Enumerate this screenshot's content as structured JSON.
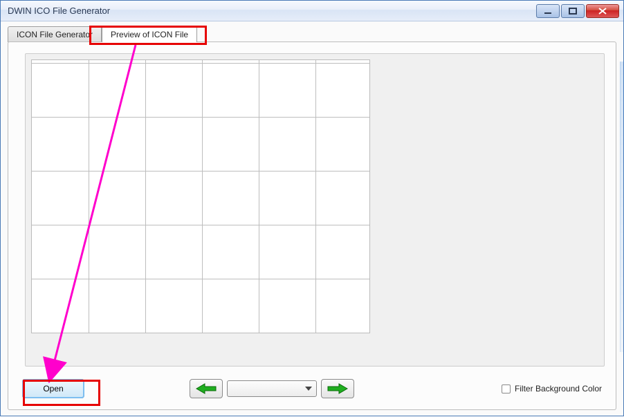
{
  "window": {
    "title": "DWIN ICO File Generator"
  },
  "tabs": {
    "generator": {
      "label": "ICON File Generator"
    },
    "preview": {
      "label": "Preview of ICON File"
    }
  },
  "buttons": {
    "open": "Open"
  },
  "dropdown": {
    "selected": ""
  },
  "checkbox": {
    "filter_bg_label": "Filter Background Color"
  },
  "icons": {
    "minimize": "minimize-icon",
    "maximize": "maximize-icon",
    "close": "close-icon",
    "arrow_left": "arrow-left-icon",
    "arrow_right": "arrow-right-icon"
  }
}
